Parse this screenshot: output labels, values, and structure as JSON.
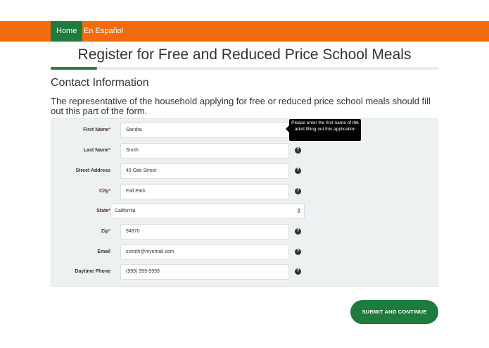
{
  "nav": {
    "home": "Home",
    "spanish": "En Español"
  },
  "page": {
    "title": "Register for Free and Reduced Price School Meals",
    "progress_fraction": 0.12
  },
  "section": {
    "title": "Contact Information",
    "description": "The representative of the household applying for free or reduced price school meals should fill out this part of the form."
  },
  "form": {
    "required_marker": "*",
    "fields": [
      {
        "label": "First Name",
        "required": true,
        "value": "Sandra"
      },
      {
        "label": "Last Name",
        "required": true,
        "value": "Smith",
        "help_icon": "question-circle-icon"
      },
      {
        "label": "Street Address",
        "required": false,
        "value": "45 Oak Street",
        "help_icon": "question-circle-icon"
      },
      {
        "label": "City",
        "required": true,
        "value": "Fall Park",
        "help_icon": "question-circle-icon"
      },
      {
        "label": "State",
        "required": true,
        "value": "California",
        "type": "select"
      },
      {
        "label": "Zip",
        "required": true,
        "value": "94870",
        "help_icon": "question-circle-icon"
      },
      {
        "label": "Email",
        "required": false,
        "value": "ssmith@myemail.com",
        "help_icon": "question-circle-icon"
      },
      {
        "label": "Daytime Phone",
        "required": false,
        "value": "(999) 999-9999",
        "help_icon": "question-circle-icon"
      }
    ]
  },
  "tooltip": {
    "text": "Please enter the first name of the adult filling out this application",
    "close": "×"
  },
  "submit": {
    "label": "SUBMIT AND CONTINUE"
  },
  "colors": {
    "brand_orange": "#f26b0f",
    "brand_green": "#1e7a3d",
    "required_red": "#d0312d"
  }
}
